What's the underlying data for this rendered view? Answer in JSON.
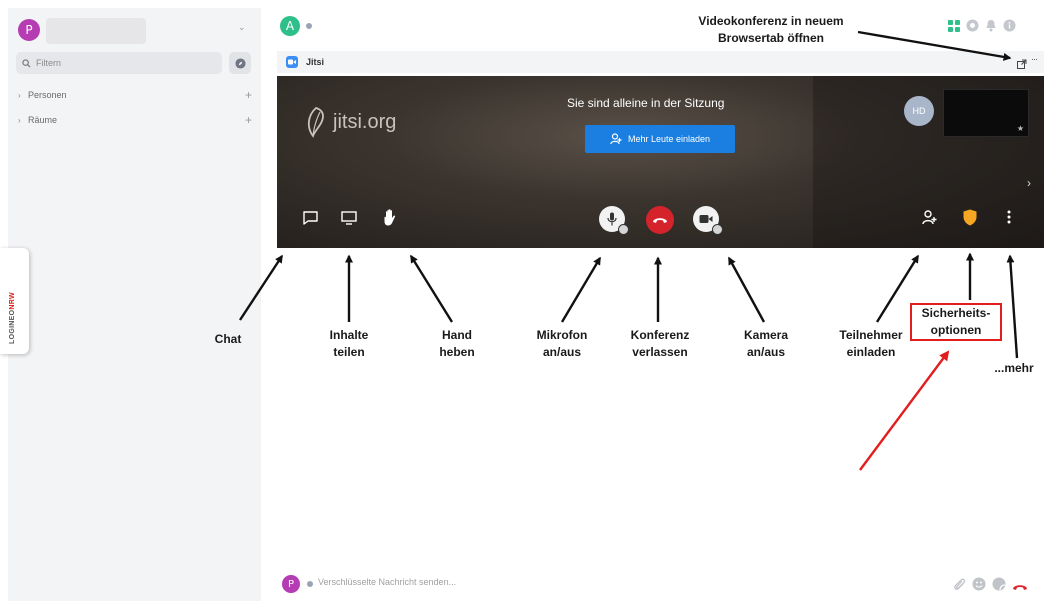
{
  "sidebar": {
    "user_initial": "P",
    "filter_placeholder": "Filtern",
    "sections": [
      {
        "label": "Personen"
      },
      {
        "label": "Räume"
      }
    ]
  },
  "side_tab": {
    "brand_prefix": "LOGINEO",
    "brand_suffix": "NRW",
    "brand_small": "MESSENGER"
  },
  "header": {
    "room_initial": "A"
  },
  "widget": {
    "title": "Jitsi"
  },
  "jitsi": {
    "logo_text": "jitsi.org",
    "alone_message": "Sie sind alleine in der Sitzung",
    "invite_label": "Mehr Leute einladen",
    "tile_initials": "HD"
  },
  "annotations": {
    "popout": [
      "Videokonferenz in neuem",
      "Browsertab öffnen"
    ],
    "chat": [
      "Chat"
    ],
    "share": [
      "Inhalte",
      "teilen"
    ],
    "hand": [
      "Hand",
      "heben"
    ],
    "mic": [
      "Mikrofon",
      "an/aus"
    ],
    "leave": [
      "Konferenz",
      "verlassen"
    ],
    "camera": [
      "Kamera",
      "an/aus"
    ],
    "invite": [
      "Teilnehmer",
      "einladen"
    ],
    "security": [
      "Sicherheits-",
      "optionen"
    ],
    "more": [
      "...mehr"
    ]
  },
  "composer": {
    "user_initial": "P",
    "placeholder": "Verschlüsselte Nachricht senden..."
  },
  "colors": {
    "accent_green": "#2fbf8a",
    "user_purple": "#b63cb4",
    "jitsi_blue": "#1a7fe0",
    "hangup_red": "#d5232c",
    "security_orange": "#f5a623",
    "annotation_red": "#e31d1d"
  }
}
